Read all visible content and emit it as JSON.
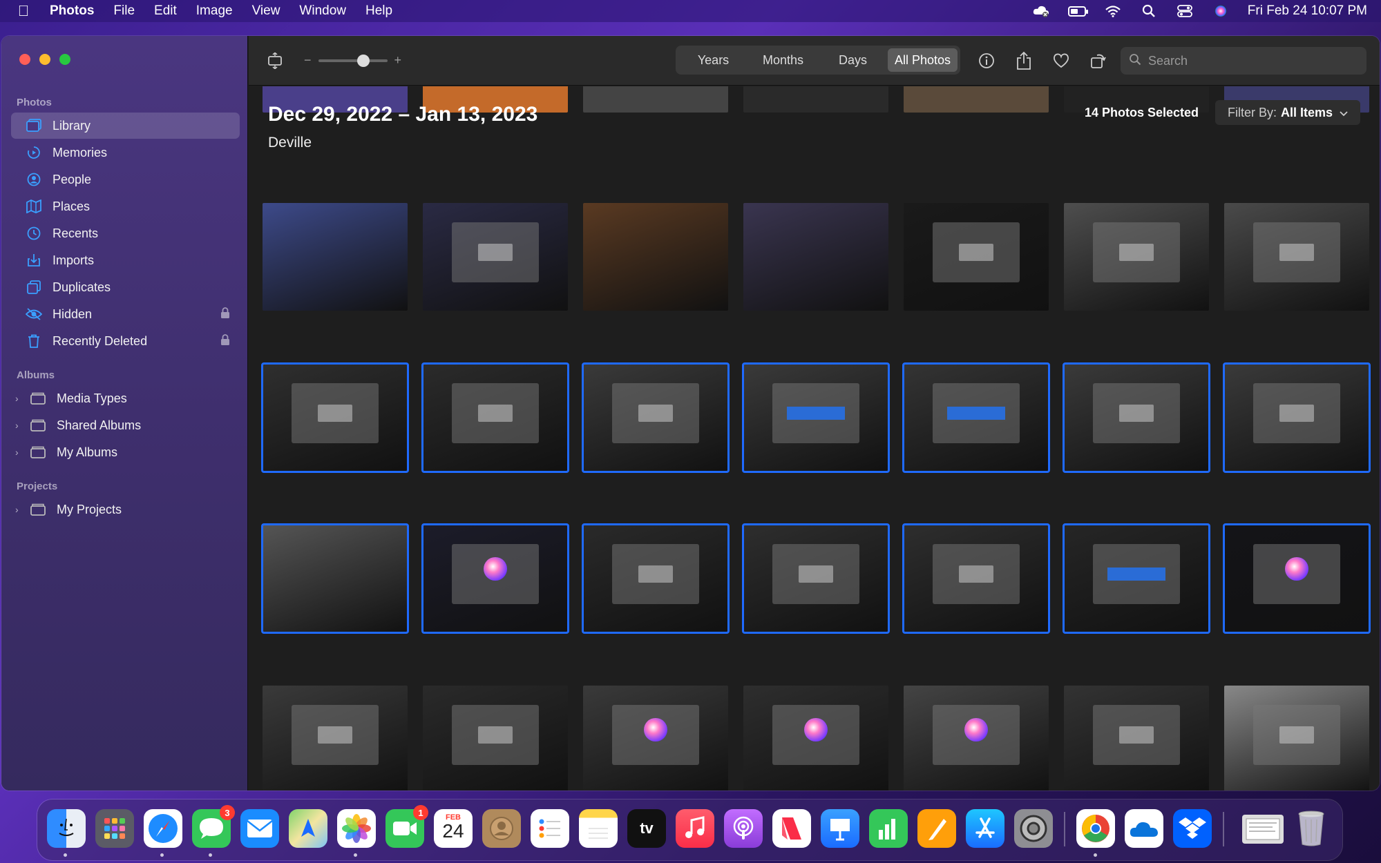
{
  "menubar": {
    "app_name": "Photos",
    "items": [
      "File",
      "Edit",
      "Image",
      "View",
      "Window",
      "Help"
    ],
    "clock": "Fri Feb 24  10:07 PM"
  },
  "sidebar": {
    "photos_heading": "Photos",
    "photos_items": [
      {
        "label": "Library",
        "icon": "library-icon",
        "selected": true
      },
      {
        "label": "Memories",
        "icon": "memories-icon"
      },
      {
        "label": "People",
        "icon": "people-icon"
      },
      {
        "label": "Places",
        "icon": "places-icon"
      },
      {
        "label": "Recents",
        "icon": "recents-icon"
      },
      {
        "label": "Imports",
        "icon": "imports-icon"
      },
      {
        "label": "Duplicates",
        "icon": "duplicates-icon"
      },
      {
        "label": "Hidden",
        "icon": "hidden-icon",
        "locked": true
      },
      {
        "label": "Recently Deleted",
        "icon": "trash-icon",
        "locked": true
      }
    ],
    "albums_heading": "Albums",
    "albums_items": [
      "Media Types",
      "Shared Albums",
      "My Albums"
    ],
    "projects_heading": "Projects",
    "projects_items": [
      "My Projects"
    ]
  },
  "toolbar": {
    "zoom_minus": "−",
    "zoom_plus": "+",
    "zoom_level": 0.56,
    "view_tabs": [
      {
        "label": "Years"
      },
      {
        "label": "Months"
      },
      {
        "label": "Days"
      },
      {
        "label": "All Photos",
        "active": true
      }
    ],
    "search_placeholder": "Search"
  },
  "content": {
    "date_range": "Dec 29, 2022 – Jan 13, 2023",
    "location": "Deville",
    "selected_count": "14 Photos Selected",
    "filter_label": "Filter By:",
    "filter_value": "All Items",
    "rows_selected": [
      false,
      true,
      true,
      false
    ]
  },
  "dock": {
    "messages_badge": "3",
    "facetime_badge": "1",
    "calendar_month": "FEB",
    "calendar_day": "24",
    "tv_label": "tv"
  },
  "colors": {
    "selection": "#1f6aff",
    "sidebar_icon": "#3aa0ff"
  }
}
